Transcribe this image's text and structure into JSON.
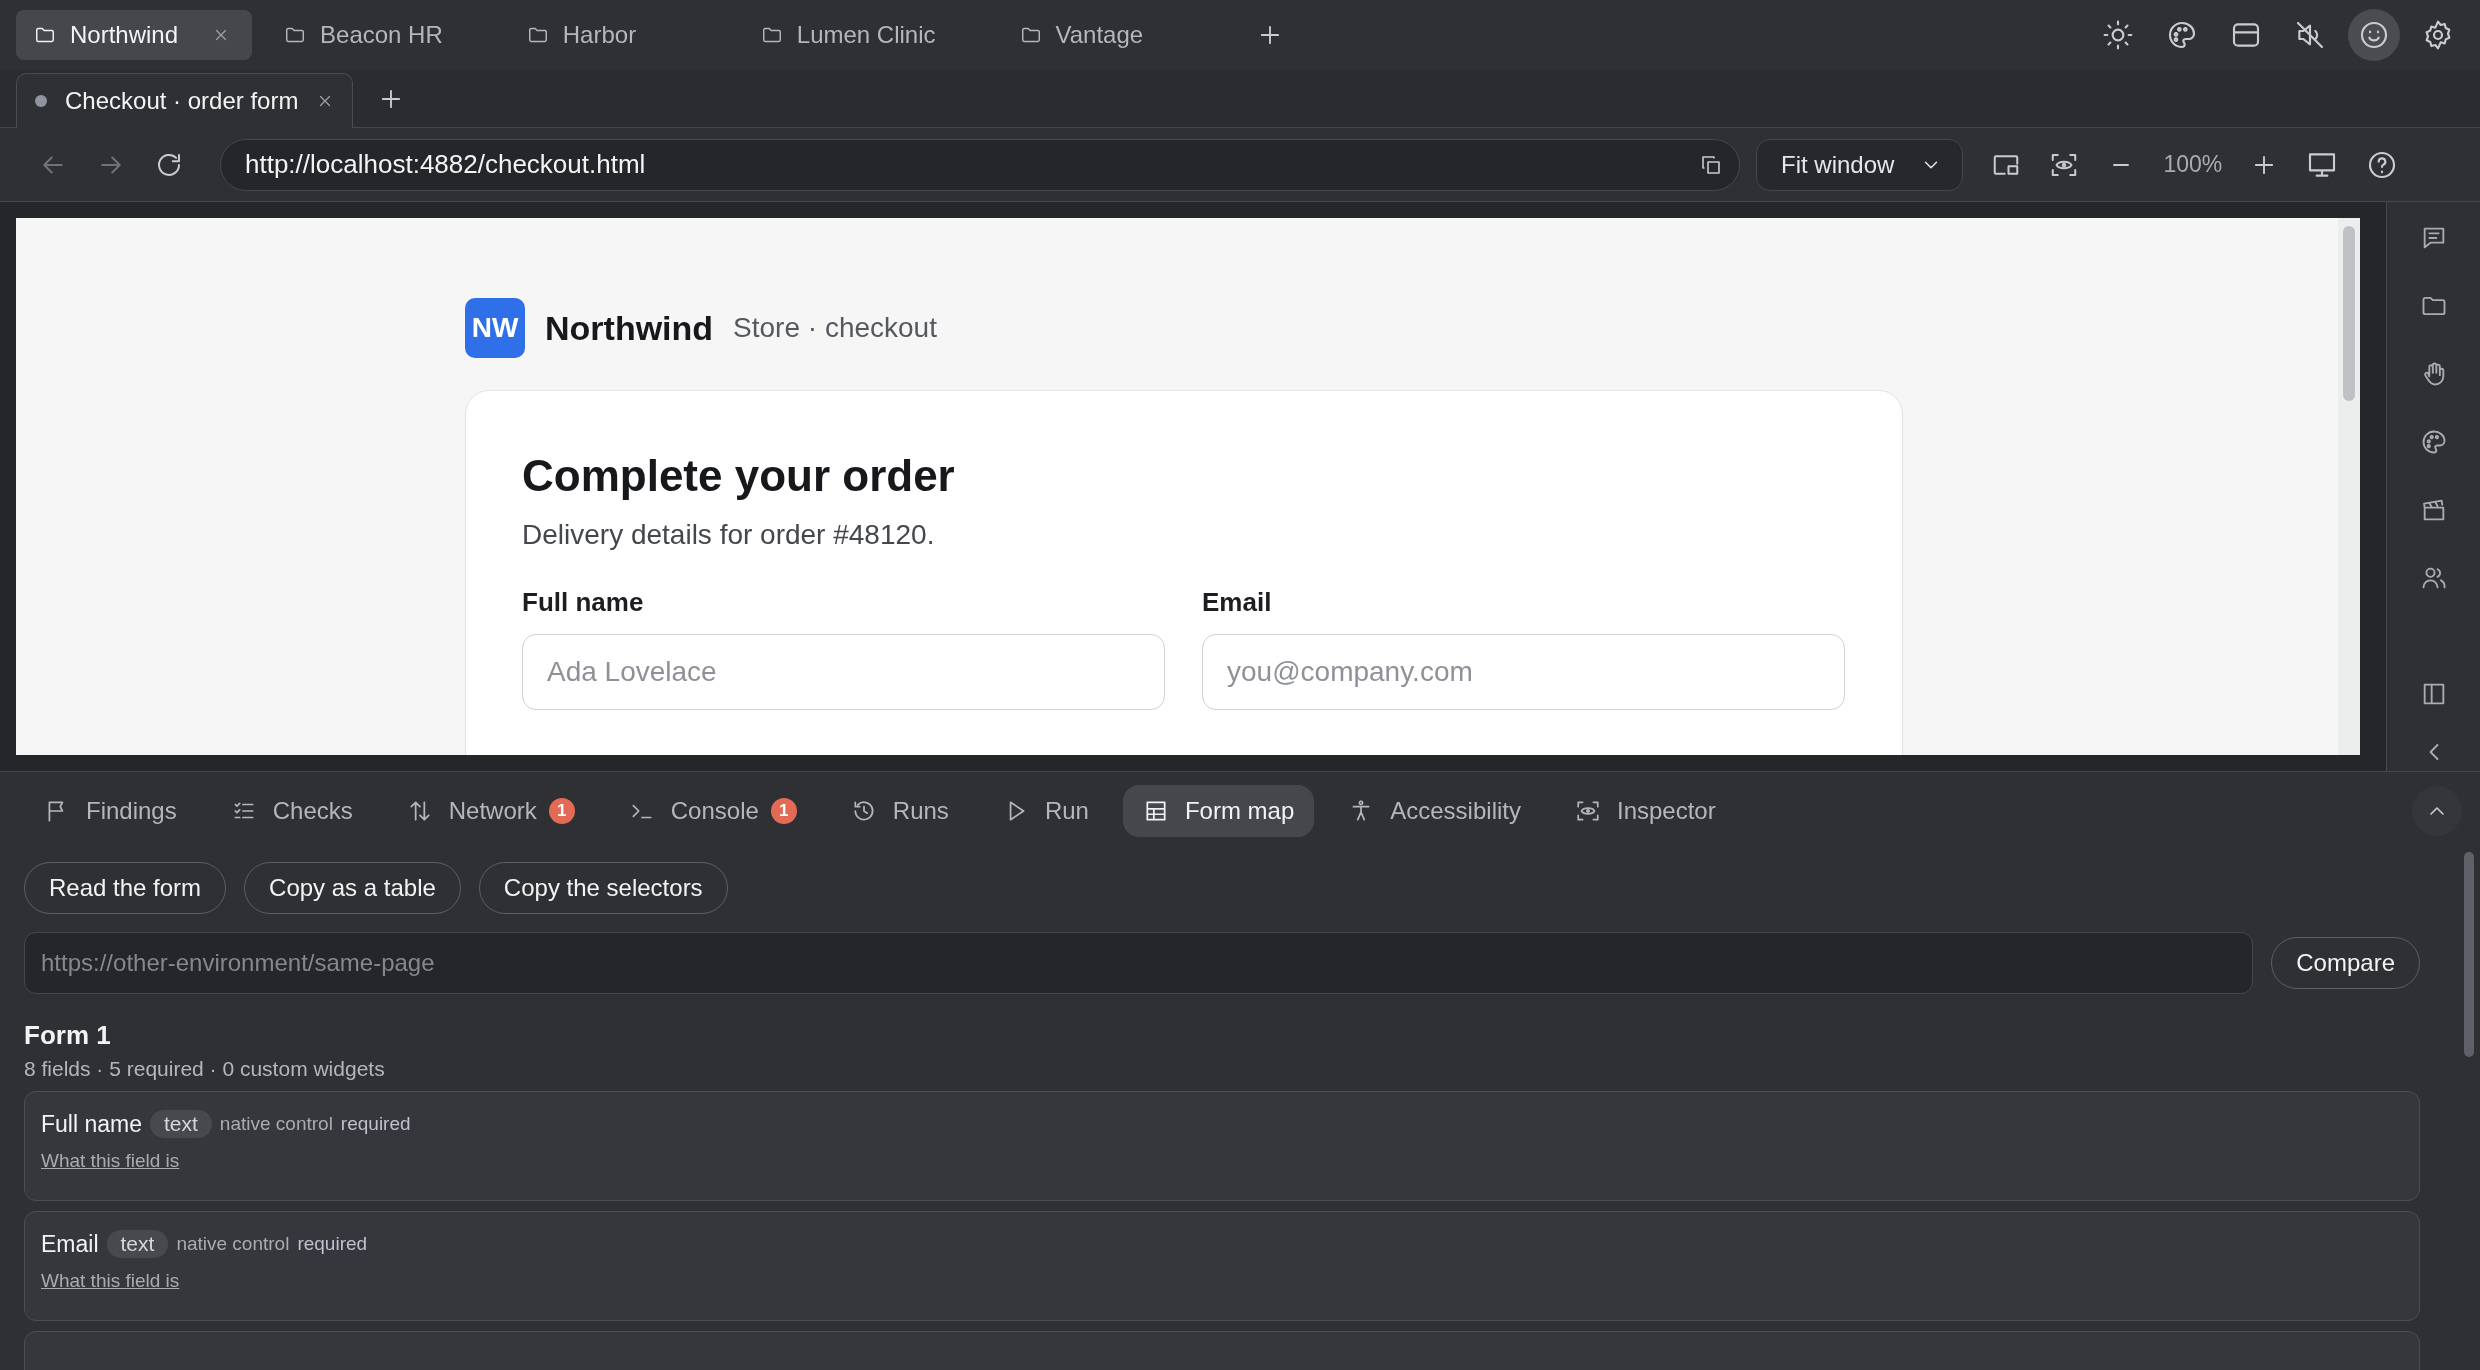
{
  "project_tabs": [
    {
      "label": "Northwind",
      "selected": true,
      "closable": true
    },
    {
      "label": "Beacon HR",
      "selected": false,
      "closable": false
    },
    {
      "label": "Harbor",
      "selected": false,
      "closable": false
    },
    {
      "label": "Lumen Clinic",
      "selected": false,
      "closable": false
    },
    {
      "label": "Vantage",
      "selected": false,
      "closable": false
    }
  ],
  "top_icons": [
    {
      "kind": "sun",
      "selected": false
    },
    {
      "kind": "palette",
      "selected": false
    },
    {
      "kind": "window",
      "selected": false
    },
    {
      "kind": "mute",
      "selected": false
    },
    {
      "kind": "smiley",
      "selected": true
    },
    {
      "kind": "gear",
      "selected": false
    }
  ],
  "page_tabs": [
    {
      "label": "Checkout · order form",
      "selected": true
    }
  ],
  "address": {
    "url": "http://localhost:4882/checkout.html",
    "fit": "Fit window",
    "zoom": "100%"
  },
  "page": {
    "logo": "NW",
    "brand": "Northwind",
    "subtitle": "Store · checkout",
    "title": "Complete your order",
    "description": "Delivery details for order #48120.",
    "fields": [
      {
        "label": "Full name",
        "placeholder": "Ada Lovelace"
      },
      {
        "label": "Email",
        "placeholder": "you@company.com"
      }
    ]
  },
  "right_sidebar": [
    {
      "kind": "comment"
    },
    {
      "kind": "folder"
    },
    {
      "kind": "hand"
    },
    {
      "kind": "palette"
    },
    {
      "kind": "clapper"
    },
    {
      "kind": "people"
    },
    {
      "kind": "panel"
    },
    {
      "kind": "chevron-left"
    }
  ],
  "devtools": {
    "tabs": [
      {
        "label": "Findings",
        "kind": "flag",
        "selected": false
      },
      {
        "label": "Checks",
        "kind": "checklist",
        "selected": false
      },
      {
        "label": "Network",
        "kind": "sort",
        "badge": "1",
        "selected": false
      },
      {
        "label": "Console",
        "kind": "terminal",
        "badge": "1",
        "selected": false
      },
      {
        "label": "Runs",
        "kind": "history",
        "selected": false
      },
      {
        "label": "Run",
        "kind": "play",
        "selected": false
      },
      {
        "label": "Form map",
        "kind": "table",
        "selected": true
      },
      {
        "label": "Accessibility",
        "kind": "access",
        "selected": false
      },
      {
        "label": "Inspector",
        "kind": "focus",
        "selected": false
      }
    ],
    "actions": [
      "Read the form",
      "Copy as a table",
      "Copy the selectors"
    ],
    "compare": {
      "placeholder": "https://other-environment/same-page",
      "button": "Compare"
    },
    "form": {
      "title": "Form 1",
      "summary": "8 fields · 5 required · 0 custom widgets",
      "fields": [
        {
          "name": "Full name",
          "type": "text",
          "control": "native control",
          "required": "required",
          "link": "What this field is"
        },
        {
          "name": "Email",
          "type": "text",
          "control": "native control",
          "required": "required",
          "link": "What this field is"
        }
      ]
    }
  }
}
